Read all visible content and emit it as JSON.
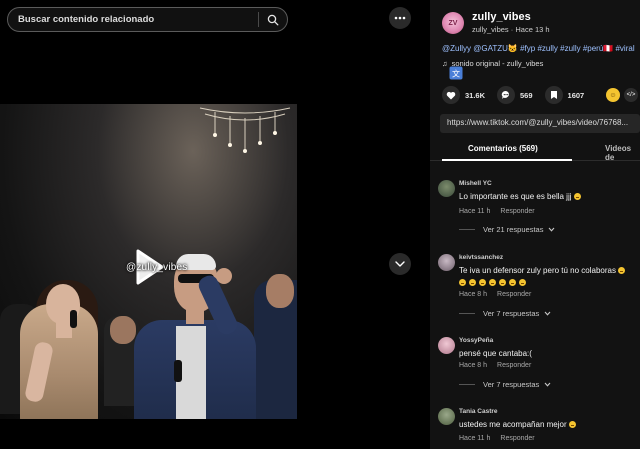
{
  "search": {
    "placeholder": "Buscar contenido relacionado"
  },
  "video": {
    "watermark": "@zully_vibes"
  },
  "author": {
    "name": "zully_vibes",
    "username": "zully_vibes",
    "separator": " · ",
    "time": "Hace 13 h"
  },
  "caption": {
    "mentions": [
      "@Zullyy",
      "@GATZU"
    ],
    "hashtags": [
      "#fyp",
      "#zully",
      "#zully",
      "#perú🇵🇪",
      "#viral"
    ]
  },
  "sound": {
    "label": "sonido original - zully_vibes"
  },
  "actions": {
    "likes": "31.6K",
    "comments": "569",
    "saves": "1607"
  },
  "share": {
    "embed_label": "</>"
  },
  "link": {
    "url": "https://www.tiktok.com/@zully_vibes/video/76768..."
  },
  "tabs": {
    "comments": "Comentarios (569)",
    "videos": "Videos de"
  },
  "comments": [
    {
      "user": "Mishell YC",
      "text": "Lo importante es que es bella jjj",
      "emoji_count": 1,
      "time": "Hace 11 h",
      "reply": "Responder",
      "replies": "Ver 21 respuestas",
      "avatar_color": "#3a4a3a"
    },
    {
      "user": "keivtssanchez",
      "text": "Te iva un defensor zuly pero tú no colaboras",
      "emoji_count": 1,
      "emoji_line": 7,
      "time": "Hace 8 h",
      "reply": "Responder",
      "replies": "Ver 7 respuestas",
      "avatar_color": "#8a7c88"
    },
    {
      "user": "YossyPeña",
      "text": "pensé que cantaba:(",
      "emoji_count": 0,
      "time": "Hace 8 h",
      "reply": "Responder",
      "replies": "Ver 7 respuestas",
      "avatar_color": "#c98fa3"
    },
    {
      "user": "Tania Castre",
      "text": "ustedes me acompañan mejor",
      "emoji_count": 1,
      "time": "Hace 11 h",
      "reply": "Responder",
      "avatar_color": "#5e6e4f"
    }
  ]
}
